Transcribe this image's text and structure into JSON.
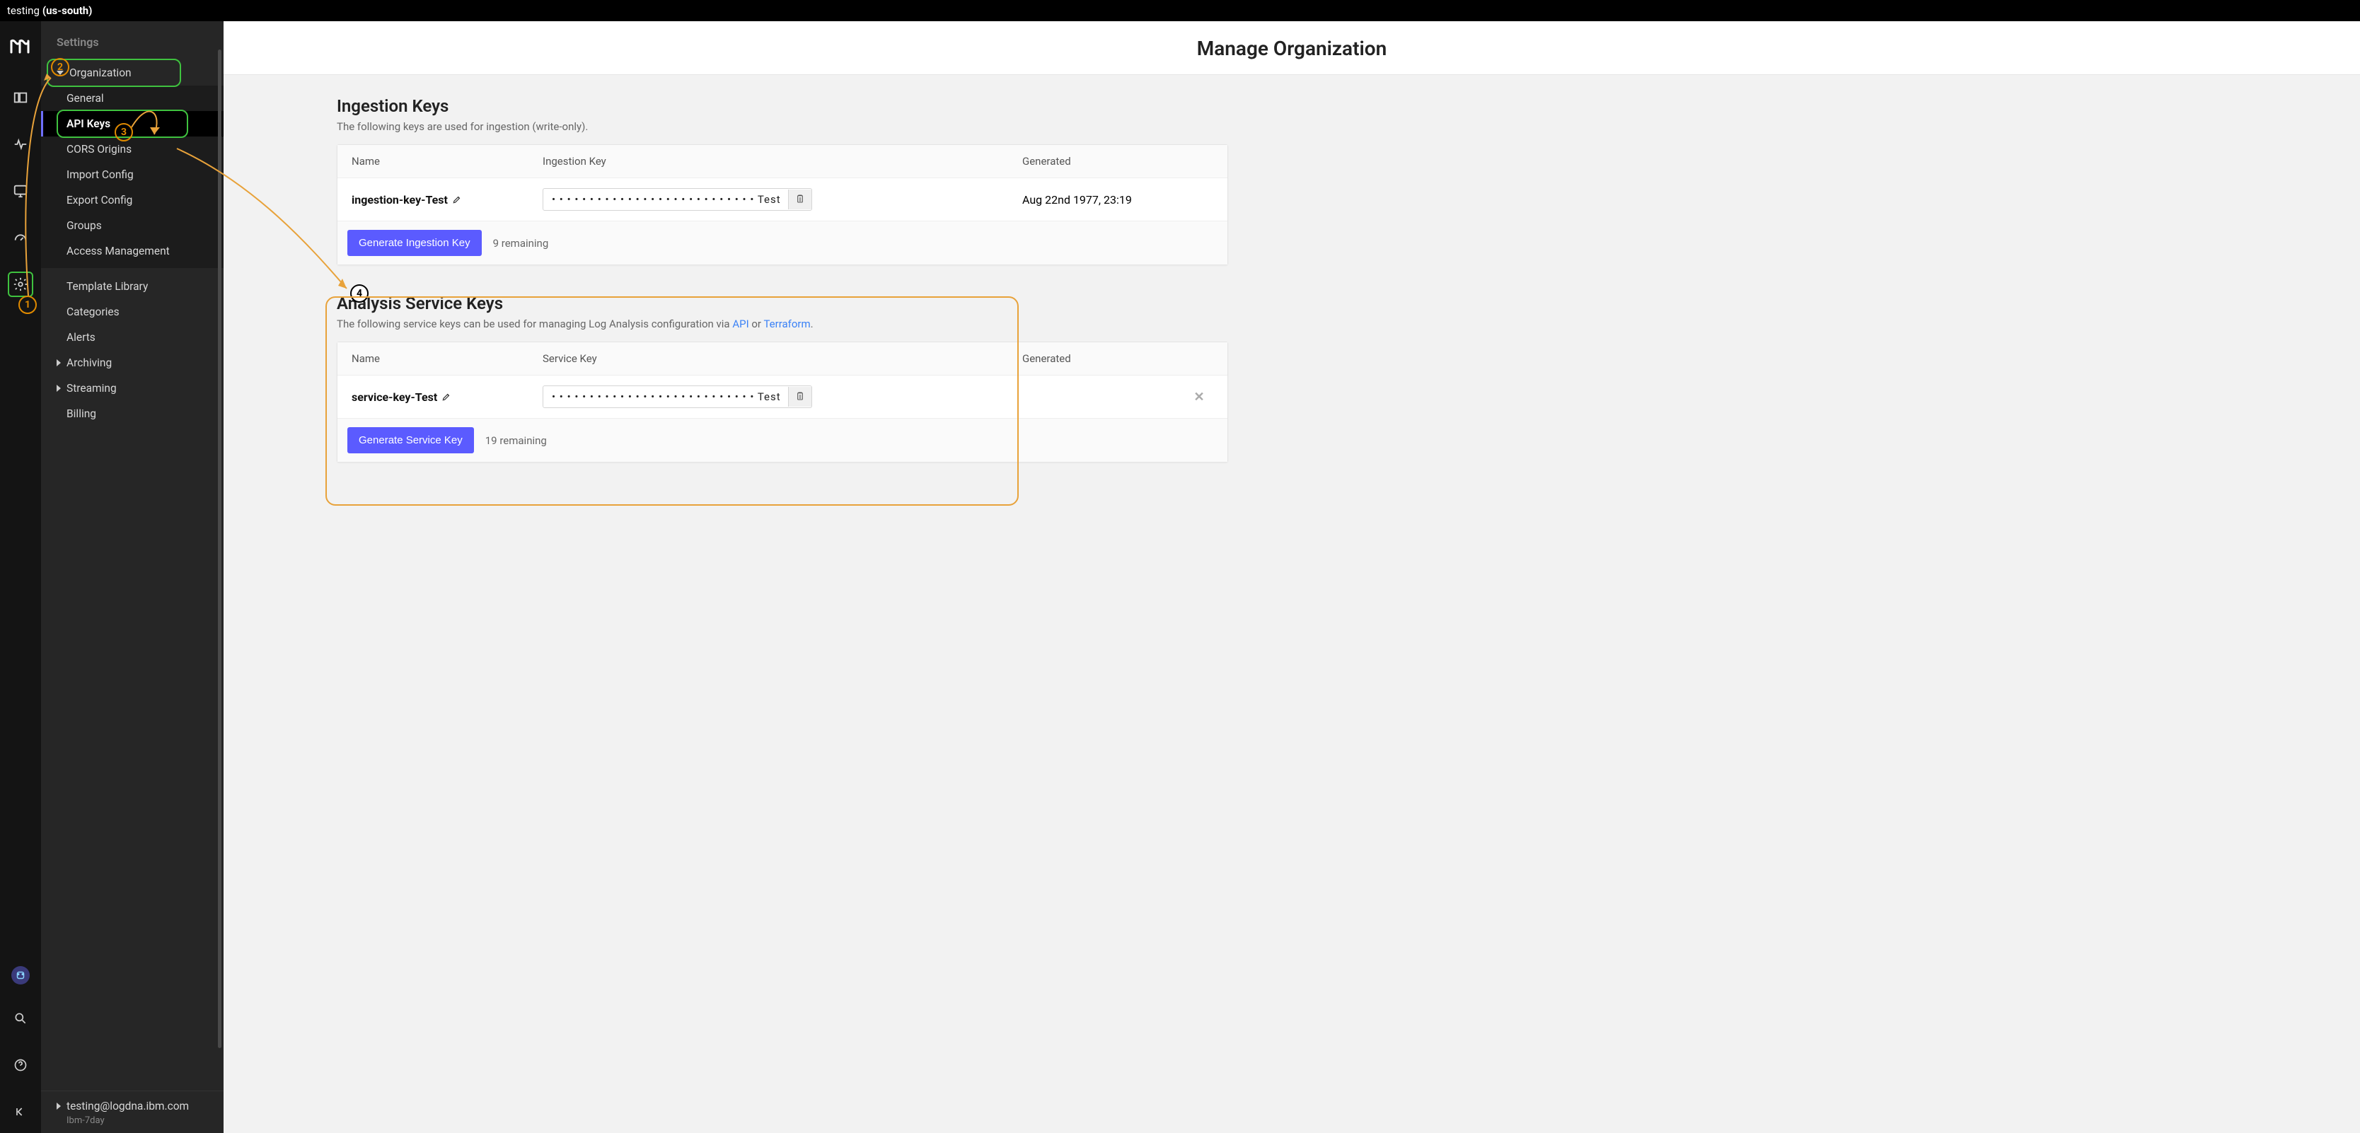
{
  "topbar": {
    "env": "testing",
    "region": "(us-south)"
  },
  "rail": {
    "icons": [
      "layout",
      "activity",
      "monitor",
      "gauge",
      "gear",
      "avatar",
      "search",
      "help",
      "collapse"
    ]
  },
  "sidebar": {
    "heading": "Settings",
    "org_label": "Organization",
    "org_items": [
      "General",
      "API Keys",
      "CORS Origins",
      "Import Config",
      "Export Config",
      "Groups",
      "Access Management"
    ],
    "active_index": 1,
    "other_items": [
      "Template Library",
      "Categories",
      "Alerts",
      "Archiving",
      "Streaming",
      "Billing"
    ],
    "footer": {
      "email": "testing@logdna.ibm.com",
      "plan": "Ibm-7day"
    }
  },
  "main": {
    "title": "Manage Organization",
    "ingestion": {
      "heading": "Ingestion Keys",
      "desc": "The following keys are used for ingestion (write-only).",
      "cols": {
        "name": "Name",
        "key": "Ingestion Key",
        "gen": "Generated"
      },
      "row": {
        "name": "ingestion-key-Test",
        "masked": "• • • • • • • • • • • • • • • • • • • • • • • • • • • Test",
        "generated": "Aug 22nd 1977, 23:19"
      },
      "button": "Generate Ingestion Key",
      "remaining": "9 remaining"
    },
    "analysis": {
      "heading": "Analysis Service Keys",
      "desc_pre": "The following service keys can be used for managing Log Analysis configuration via ",
      "link_api": "API",
      "desc_mid": " or ",
      "link_tf": "Terraform",
      "desc_post": ".",
      "cols": {
        "name": "Name",
        "key": "Service Key",
        "gen": "Generated"
      },
      "row": {
        "name": "service-key-Test",
        "masked": "• • • • • • • • • • • • • • • • • • • • • • • • • • • Test",
        "generated": ""
      },
      "button": "Generate Service Key",
      "remaining": "19 remaining"
    }
  },
  "annotations": {
    "1": "1",
    "2": "2",
    "3": "3",
    "4": "4"
  }
}
